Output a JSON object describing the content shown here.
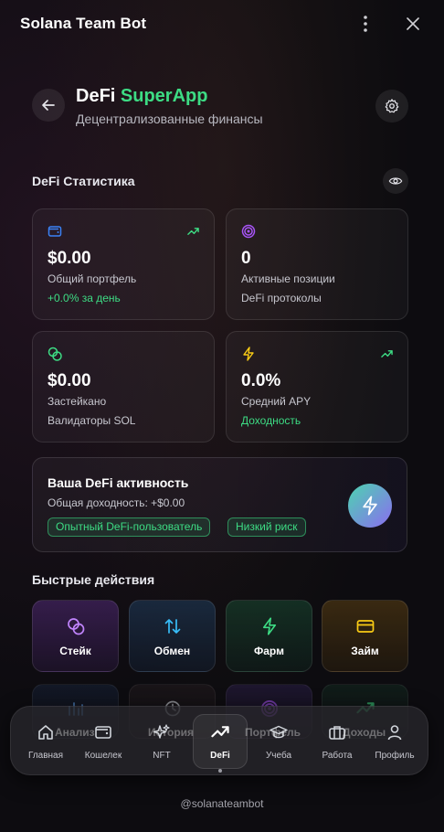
{
  "window": {
    "title": "Solana Team Bot"
  },
  "header": {
    "title_main": "DeFi",
    "title_accent": "SuperApp",
    "subtitle": "Децентрализованные финансы"
  },
  "stats": {
    "section_title": "DeFi Статистика",
    "cards": [
      {
        "value": "$0.00",
        "label": "Общий портфель",
        "sub": "+0.0% за день",
        "icon": "wallet-icon",
        "accent": "#3b82f6"
      },
      {
        "value": "0",
        "label": "Активные позиции",
        "sub": "DeFi протоколы",
        "icon": "target-icon",
        "accent": "#a855f7"
      },
      {
        "value": "$0.00",
        "label": "Застейкано",
        "sub": "Валидаторы SOL",
        "icon": "coins-icon",
        "accent": "#3ddc84"
      },
      {
        "value": "0.0%",
        "label": "Средний APY",
        "sub": "Доходность",
        "icon": "bolt-icon",
        "accent": "#facc15"
      }
    ]
  },
  "activity": {
    "title": "Ваша DeFi активность",
    "subtitle": "Общая доходность: +$0.00",
    "badges": [
      "Опытный DeFi-пользователь",
      "Низкий риск"
    ]
  },
  "quick_actions": {
    "section_title": "Быстрые действия",
    "items": [
      {
        "label": "Стейк",
        "icon": "coins-icon"
      },
      {
        "label": "Обмен",
        "icon": "swap-icon"
      },
      {
        "label": "Фарм",
        "icon": "bolt-icon"
      },
      {
        "label": "Займ",
        "icon": "card-icon"
      }
    ],
    "row2_labels": [
      "Анализ",
      "История",
      "Портфель",
      "Доходы"
    ]
  },
  "nav": {
    "items": [
      {
        "label": "Главная",
        "icon": "home-icon"
      },
      {
        "label": "Кошелек",
        "icon": "wallet-icon"
      },
      {
        "label": "NFT",
        "icon": "sparkles-icon"
      },
      {
        "label": "DeFi",
        "icon": "trend-icon",
        "active": true
      },
      {
        "label": "Учеба",
        "icon": "graduation-icon"
      },
      {
        "label": "Работа",
        "icon": "briefcase-icon"
      },
      {
        "label": "Профиль",
        "icon": "user-icon"
      }
    ]
  },
  "footer": {
    "handle": "@solanateambot"
  },
  "colors": {
    "accent_green": "#3ddc84",
    "background": "#0d0c10"
  }
}
